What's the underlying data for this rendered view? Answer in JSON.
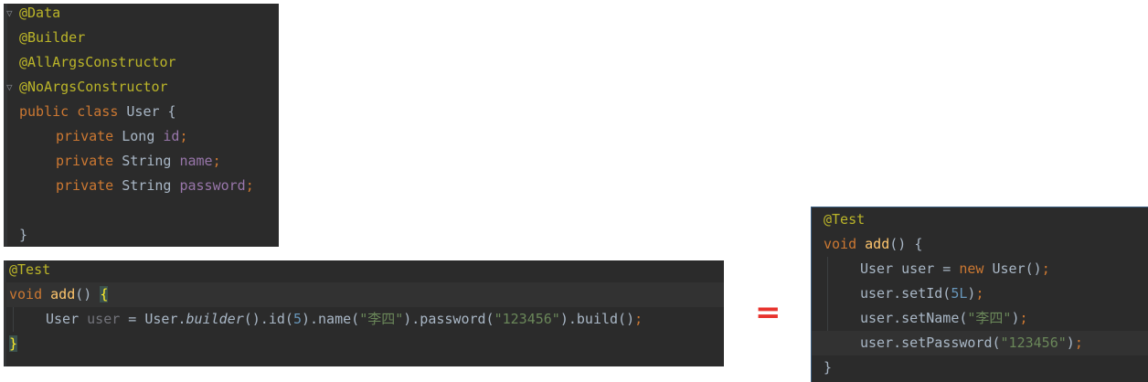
{
  "panel1": {
    "l1": "@Data",
    "l2": "@Builder",
    "l3": "@AllArgsConstructor",
    "l4": "@NoArgsConstructor",
    "l5": {
      "public": "public",
      "class": "class",
      "name": "User",
      "brace": " {"
    },
    "l6": {
      "private": "private",
      "type": "Long",
      "field": "id",
      "semi": ";"
    },
    "l7": {
      "private": "private",
      "type": "String",
      "field": "name",
      "semi": ";"
    },
    "l8": {
      "private": "private",
      "type": "String",
      "field": "password",
      "semi": ";"
    },
    "l10": "}"
  },
  "panel2": {
    "l1": "@Test",
    "l2": {
      "void": "void",
      "method": "add",
      "parens": "() ",
      "brace": "{"
    },
    "l3": {
      "type": "User",
      "var": "user",
      "eq": " = User.",
      "builder": "builder",
      "p1": "().id(",
      "n1": "5",
      "p2": ").name(",
      "s1": "\"李四\"",
      "p3": ").password(",
      "s2": "\"123456\"",
      "p4": ").build()",
      "semi": ";"
    },
    "l4": "}"
  },
  "equals_sign": "=",
  "panel3": {
    "l1": "@Test",
    "l2": {
      "void": "void",
      "method": "add",
      "rest": "() {"
    },
    "l3": {
      "a": "User user = ",
      "new": "new",
      "b": " User()",
      "semi": ";"
    },
    "l4": {
      "a": "user.setId(",
      "n": "5L",
      "b": ")",
      "semi": ";"
    },
    "l5": {
      "a": "user.setName(",
      "s": "\"李四\"",
      "b": ")",
      "semi": ";"
    },
    "l6": {
      "a": "user.setPassword(",
      "s": "\"123456\"",
      "b": ")",
      "semi": ";"
    },
    "l7": "}"
  },
  "colors": {
    "editor_bg": "#2b2b2b",
    "keyword": "#cc7832",
    "annotation": "#bbb529",
    "field": "#9876aa",
    "method": "#ffc66d",
    "string": "#6a8759",
    "number": "#6897bb",
    "equals": "#e8332d"
  }
}
